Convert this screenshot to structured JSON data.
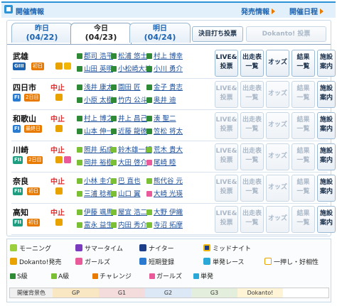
{
  "header": {
    "title": "開催情報",
    "link1": "発売情報",
    "link2": "開催日程"
  },
  "tabs": [
    {
      "label": "昨日",
      "date": "(04/22)"
    },
    {
      "label": "今日",
      "date": "(04/23)"
    },
    {
      "label": "明日",
      "date": "(04/24)"
    }
  ],
  "buttons": {
    "kettei": "決目打ち投票",
    "dokanto": "Dokanto! 投票",
    "live": "LIVE&",
    "live2": "投票",
    "shusso": "出走表",
    "shusso2": "一覧",
    "odds": "オッズ",
    "kekka": "結果",
    "kekka2": "一覧",
    "shisetsu": "施設",
    "shisetsu2": "案内"
  },
  "venues": [
    {
      "name": "武雄",
      "cancel": "",
      "grade": "GIII",
      "day": "初日",
      "riders": [
        [
          "S",
          "郡司 浩平"
        ],
        [
          "S",
          "松浦 悠士"
        ],
        [
          "S",
          "村上 博幸"
        ],
        [
          "S",
          "山田 英明"
        ],
        [
          "S",
          "小松崎大地"
        ],
        [
          "S",
          "小川 勇介"
        ]
      ]
    },
    {
      "name": "四日市",
      "cancel": "中止",
      "grade": "FI",
      "day": "2日目",
      "riders": [
        [
          "S",
          "浅井 康太"
        ],
        [
          "S",
          "園田 匠"
        ],
        [
          "S",
          "金子 貴志"
        ],
        [
          "S",
          "小原 太樹"
        ],
        [
          "S",
          "竹内 公斗"
        ],
        [
          "S",
          "奥井 迪"
        ]
      ]
    },
    {
      "name": "和歌山",
      "cancel": "中止",
      "grade": "FI",
      "day": "最終日",
      "riders": [
        [
          "S",
          "村上 博之"
        ],
        [
          "S",
          "井上 昌己"
        ],
        [
          "S",
          "湊 聖二"
        ],
        [
          "S",
          "山本 伸一"
        ],
        [
          "S",
          "近藤 龍徳"
        ],
        [
          "S",
          "笠松 将太"
        ]
      ]
    },
    {
      "name": "川崎",
      "cancel": "中止",
      "grade": "FII",
      "day": "2日目",
      "riders": [
        [
          "A",
          "照井 拓成"
        ],
        [
          "A",
          "鈴木雄一朗"
        ],
        [
          "A",
          "荒木 貴大"
        ],
        [
          "A",
          "岡井 裕樹"
        ],
        [
          "A",
          "大田 啓介"
        ],
        [
          "G",
          "尾崎 睦"
        ]
      ]
    },
    {
      "name": "奈良",
      "cancel": "中止",
      "grade": "FII",
      "day": "初日",
      "riders": [
        [
          "A",
          "小林 圭介"
        ],
        [
          "A",
          "巴 直也"
        ],
        [
          "A",
          "熊代谷 元"
        ],
        [
          "A",
          "三浦 稔希"
        ],
        [
          "A",
          "山口 翼"
        ],
        [
          "G",
          "大崎 光瑛"
        ]
      ]
    },
    {
      "name": "高知",
      "cancel": "中止",
      "grade": "FII",
      "day": "初日",
      "riders": [
        [
          "A",
          "伊藤 颯馬"
        ],
        [
          "A",
          "屋宜 浩二"
        ],
        [
          "A",
          "大野 伊織"
        ],
        [
          "A",
          "富永 益生"
        ],
        [
          "A",
          "内田 秀介"
        ],
        [
          "A",
          "寺沼 拓摩"
        ]
      ]
    }
  ],
  "legend": {
    "morning": "モーニング",
    "summer": "サマータイム",
    "nighter": "ナイター",
    "midnight": "ミッドナイト",
    "dokanto": "Dokanto!発売",
    "girls": "ガールズ",
    "tanki": "短期登録",
    "tanpatsu": "単発レース",
    "ichioshi": "一押し・好相性",
    "s": "S級",
    "a": "A級",
    "challenge": "チャレンジ",
    "girls2": "ガールズ",
    "tanpatsu2": "単発",
    "colorlabel": "開催背景色",
    "gp": "GP",
    "g1": "G1",
    "g2": "G2",
    "g3": "G3",
    "dk": "Dokanto!"
  },
  "colors": {
    "accent": "#2c93d6",
    "cancel": "#e03030",
    "morning": "#9bcf3c",
    "summer": "#7a3bbf",
    "nighter": "#1d3f8a",
    "midnight": "#f2b705",
    "dokanto": "#e8a300",
    "girls": "#e85a9a"
  }
}
